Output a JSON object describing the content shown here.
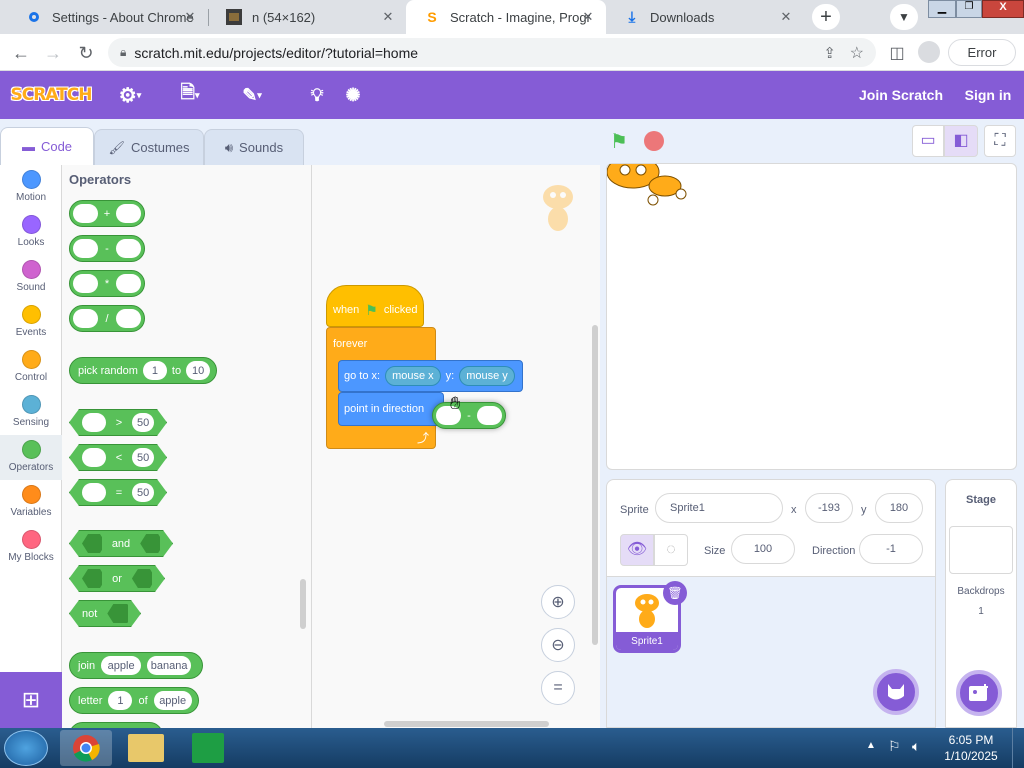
{
  "browser": {
    "tabs": [
      {
        "title": "Settings - About Chrome",
        "icon": "gear-icon"
      },
      {
        "title": "n (54×162)",
        "icon": "image-icon"
      },
      {
        "title": "Scratch - Imagine, Progra",
        "icon": "scratch-icon"
      },
      {
        "title": "Downloads",
        "icon": "download-icon"
      }
    ],
    "url": "scratch.mit.edu/projects/editor/?tutorial=home",
    "error_button": "Error"
  },
  "menubar": {
    "logo": "SCRATCH",
    "join": "Join Scratch",
    "signin": "Sign in"
  },
  "editor_tabs": {
    "code": "Code",
    "costumes": "Costumes",
    "sounds": "Sounds"
  },
  "categories": [
    {
      "label": "Motion",
      "color": "#4c97ff"
    },
    {
      "label": "Looks",
      "color": "#9966ff"
    },
    {
      "label": "Sound",
      "color": "#cf63cf"
    },
    {
      "label": "Events",
      "color": "#ffbf00"
    },
    {
      "label": "Control",
      "color": "#ffab19"
    },
    {
      "label": "Sensing",
      "color": "#5cb1d6"
    },
    {
      "label": "Operators",
      "color": "#59c059"
    },
    {
      "label": "Variables",
      "color": "#ff8c1a"
    },
    {
      "label": "My Blocks",
      "color": "#ff6680"
    }
  ],
  "palette": {
    "heading": "Operators",
    "plus": "+",
    "minus": "-",
    "times": "*",
    "divide": "/",
    "pick_random": "pick random",
    "pick_from": "1",
    "to": "to",
    "pick_to": "10",
    "gt": ">",
    "lt": "<",
    "eq": "=",
    "cmp_value": "50",
    "and": "and",
    "or": "or",
    "not": "not",
    "join": "join",
    "join_a": "apple",
    "join_b": "banana",
    "letter": "letter",
    "letter_n": "1",
    "of": "of",
    "letter_s": "apple"
  },
  "script": {
    "when": "when",
    "clicked": "clicked",
    "forever": "forever",
    "goto": "go to x:",
    "mouse_x": "mouse x",
    "y": "y:",
    "mouse_y": "mouse y",
    "point": "point in direction",
    "minus": "-"
  },
  "sprite_info": {
    "sprite_label": "Sprite",
    "sprite_name": "Sprite1",
    "x_label": "x",
    "x": "-193",
    "y_label": "y",
    "y": "180",
    "size_label": "Size",
    "size": "100",
    "direction_label": "Direction",
    "direction": "-1"
  },
  "sprite_list": [
    {
      "name": "Sprite1"
    }
  ],
  "stage_panel": {
    "title": "Stage",
    "backdrops_label": "Backdrops",
    "backdrops": "1"
  },
  "taskbar": {
    "time": "6:05 PM",
    "date": "1/10/2025"
  }
}
